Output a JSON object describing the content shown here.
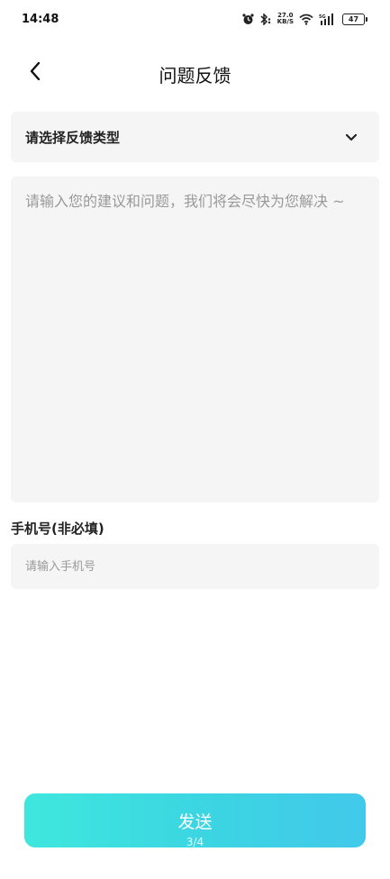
{
  "status_bar": {
    "time": "14:48",
    "speed_value": "27.0",
    "speed_unit": "KB/S",
    "network": "5G",
    "battery": "47"
  },
  "nav": {
    "back_icon": "chevron-left-icon",
    "title": "问题反馈"
  },
  "feedback_type": {
    "placeholder": "请选择反馈类型",
    "icon": "chevron-down-icon"
  },
  "content": {
    "placeholder": "请输入您的建议和问题，我们将会尽快为您解决 ~",
    "value": ""
  },
  "phone": {
    "label": "手机号(非必填)",
    "placeholder": "请输入手机号",
    "value": ""
  },
  "submit": {
    "label": "发送"
  },
  "page_indicator": "3/4",
  "colors": {
    "accent_start": "#3ee7dd",
    "accent_end": "#42c9ea",
    "field_bg": "#f5f5f5",
    "placeholder_text": "#999999"
  }
}
